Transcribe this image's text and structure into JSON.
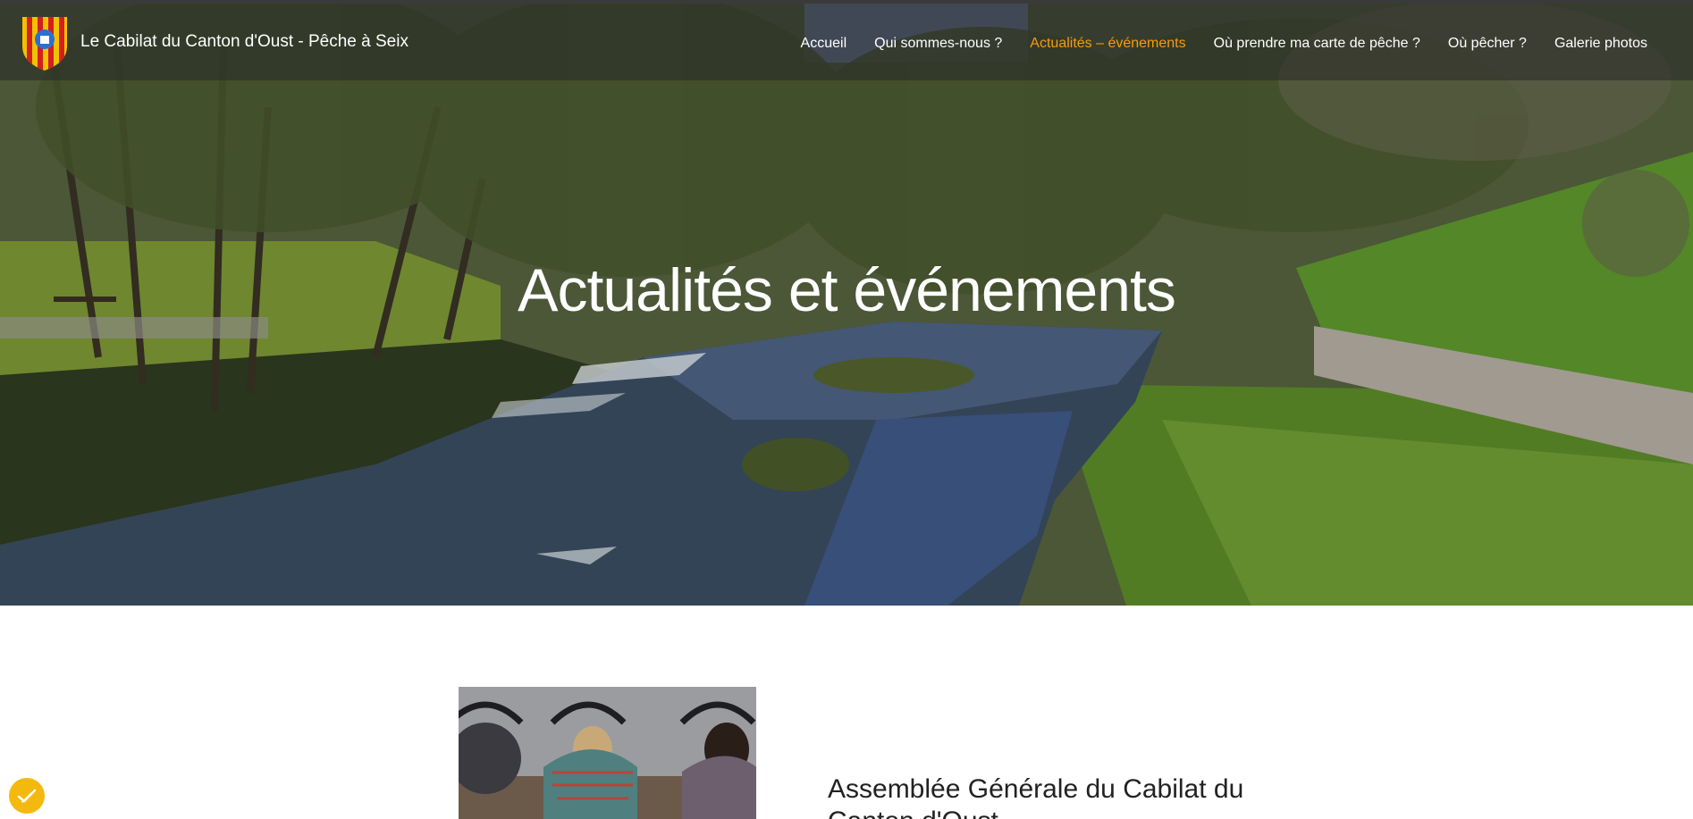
{
  "header": {
    "site_title": "Le Cabilat du Canton d'Oust - Pêche à Seix",
    "nav": [
      {
        "label": "Accueil",
        "active": false
      },
      {
        "label": "Qui sommes-nous ?",
        "active": false
      },
      {
        "label": "Actualités – événements",
        "active": true
      },
      {
        "label": "Où prendre ma carte de pêche ?",
        "active": false
      },
      {
        "label": "Où pêcher ?",
        "active": false
      },
      {
        "label": "Galerie photos",
        "active": false
      }
    ]
  },
  "hero": {
    "title": "Actualités et événements"
  },
  "article": {
    "title": "Assemblée Générale du Cabilat du Canton d'Oust"
  },
  "colors": {
    "accent": "#f39c12",
    "badge": "#f3b90f"
  },
  "icons": {
    "logo": "coat-of-arms-icon",
    "badge": "check-icon"
  }
}
